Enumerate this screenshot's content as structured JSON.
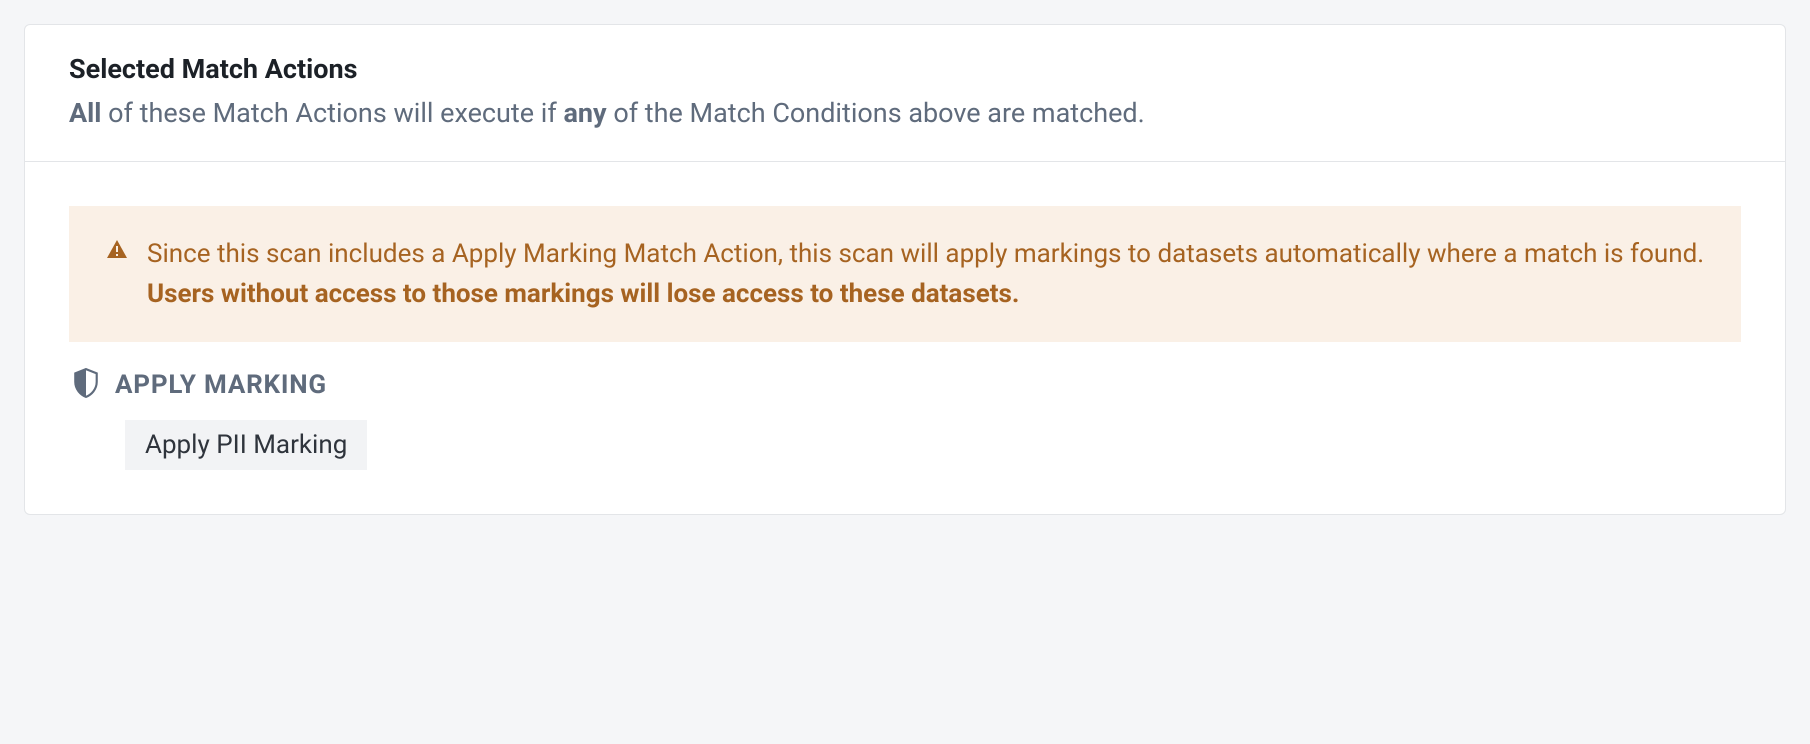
{
  "header": {
    "title": "Selected Match Actions",
    "subtitle_prefix_bold": "All",
    "subtitle_mid": " of these Match Actions will execute if ",
    "subtitle_mid_bold": "any",
    "subtitle_suffix": " of the Match Conditions above are matched."
  },
  "warning": {
    "text_plain": "Since this scan includes a Apply Marking Match Action, this scan will apply markings to datasets automatically where a match is found. ",
    "text_bold": "Users without access to those markings will lose access to these datasets."
  },
  "action": {
    "label": "APPLY MARKING",
    "button_label": "Apply PII Marking"
  }
}
